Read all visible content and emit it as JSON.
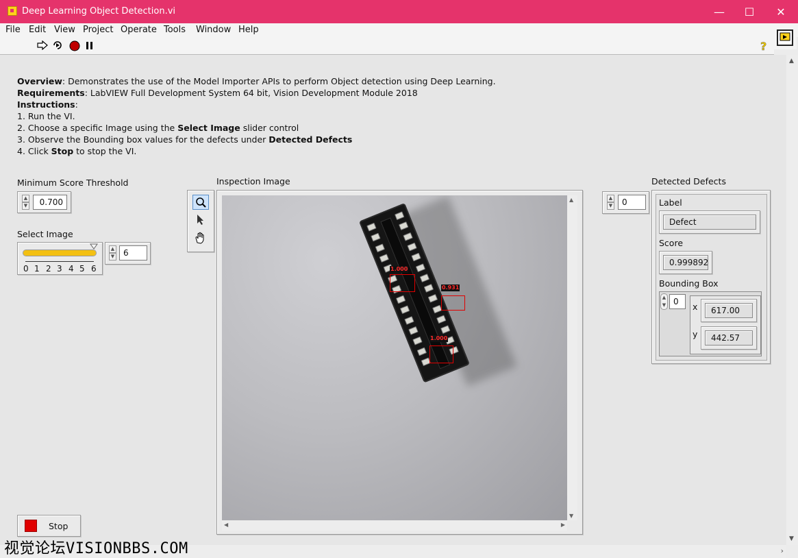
{
  "window": {
    "title": "Deep Learning Object Detection.vi"
  },
  "menu": [
    "File",
    "Edit",
    "View",
    "Project",
    "Operate",
    "Tools",
    "Window",
    "Help"
  ],
  "toolbar_icons": [
    "run-arrow-icon",
    "run-continuous-icon",
    "abort-icon",
    "pause-icon",
    "help-icon"
  ],
  "description": {
    "overview_label": "Overview",
    "overview_text": ": Demonstrates the use of the Model Importer APIs to perform Object detection using Deep Learning.",
    "requirements_label": "Requirements",
    "requirements_text": ": LabVIEW Full Development System 64 bit, Vision Development Module 2018",
    "instructions_label": "Instructions",
    "instructions_colon": ":",
    "step1": "1. Run the VI.",
    "step2_pre": "2. Choose a specific Image using the ",
    "step2_bold": "Select Image",
    "step2_post": " slider control",
    "step3_pre": "3. Observe the Bounding box values for the defects under ",
    "step3_bold": "Detected Defects",
    "step4_pre": "4. Click ",
    "step4_bold": "Stop",
    "step4_post": " to stop the VI."
  },
  "min_score": {
    "label": "Minimum Score Threshold",
    "value": "0.700"
  },
  "select_image": {
    "label": "Select Image",
    "ticks": [
      "0",
      "1",
      "2",
      "3",
      "4",
      "5",
      "6"
    ],
    "value": "6",
    "level": 1.0
  },
  "inspection": {
    "label": "Inspection Image",
    "detections": [
      {
        "score": "1.000"
      },
      {
        "score": "0.931"
      },
      {
        "score": "1.000"
      }
    ]
  },
  "defects": {
    "label": "Detected Defects",
    "index": "0",
    "label_caption": "Label",
    "label_value": "Defect",
    "score_caption": "Score",
    "score_value": "0.999892",
    "bbox_caption": "Bounding Box",
    "bbox_index": "0",
    "x_caption": "x",
    "x_value": "617.00",
    "y_caption": "y",
    "y_value": "442.57"
  },
  "stop_button": {
    "label": "Stop"
  },
  "watermark": "视觉论坛VISIONBBS.COM",
  "colors": {
    "titlebar": "#e5336b",
    "slider_fill": "#f3c012",
    "bbox": "#e00000"
  }
}
